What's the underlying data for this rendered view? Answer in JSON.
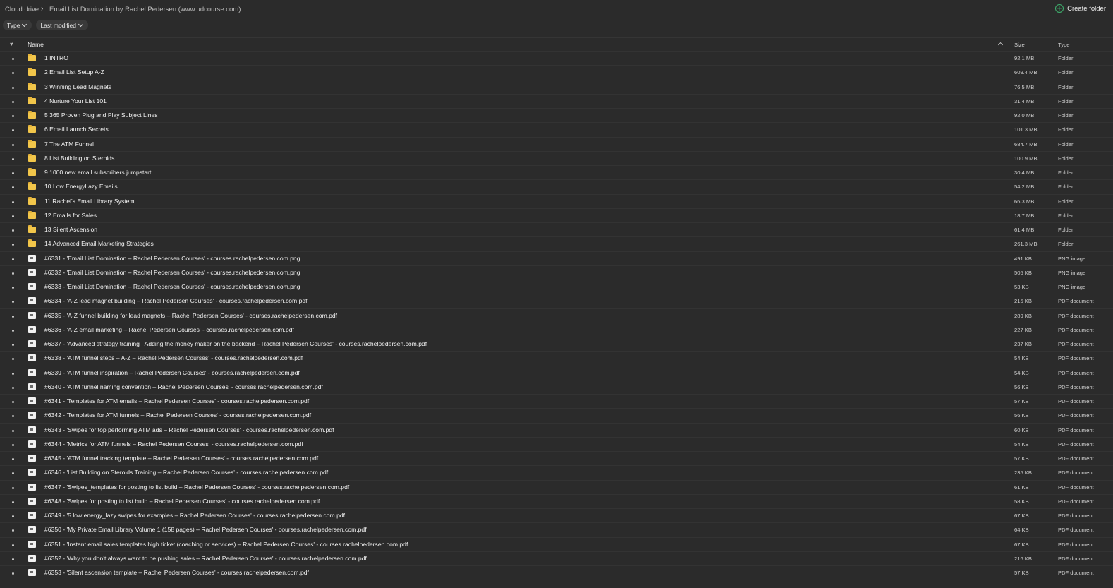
{
  "breadcrumb": {
    "root": "Cloud drive",
    "separator": "›",
    "current": "Email List Domination by Rachel Pedersen (www.udcourse.com)"
  },
  "toolbar": {
    "create_folder_label": "Create folder",
    "filters": [
      {
        "label": "Type"
      },
      {
        "label": "Last modified"
      }
    ]
  },
  "columns": {
    "favourite_icon": "heart-icon",
    "name": "Name",
    "size": "Size",
    "type": "Type",
    "sort": "ascending"
  },
  "colors": {
    "background": "#2b2b2b",
    "folder": "#f2c64a",
    "accent": "#3fb36f"
  },
  "files": [
    {
      "name": "1 INTRO",
      "size": "92.1 MB",
      "type": "Folder",
      "icon": "folder-icon"
    },
    {
      "name": "2 Email List Setup A-Z",
      "size": "609.4 MB",
      "type": "Folder",
      "icon": "folder-icon"
    },
    {
      "name": "3 Winning Lead Magnets",
      "size": "76.5 MB",
      "type": "Folder",
      "icon": "folder-icon"
    },
    {
      "name": "4 Nurture Your List 101",
      "size": "31.4 MB",
      "type": "Folder",
      "icon": "folder-icon"
    },
    {
      "name": "5 365 Proven Plug and Play Subject Lines",
      "size": "92.0 MB",
      "type": "Folder",
      "icon": "folder-icon"
    },
    {
      "name": "6 Email Launch Secrets",
      "size": "101.3 MB",
      "type": "Folder",
      "icon": "folder-icon"
    },
    {
      "name": "7 The ATM Funnel",
      "size": "684.7 MB",
      "type": "Folder",
      "icon": "folder-icon"
    },
    {
      "name": "8 List Building on Steroids",
      "size": "100.9 MB",
      "type": "Folder",
      "icon": "folder-icon"
    },
    {
      "name": "9 1000 new email subscribers jumpstart",
      "size": "30.4 MB",
      "type": "Folder",
      "icon": "folder-icon"
    },
    {
      "name": "10 Low EnergyLazy Emails",
      "size": "54.2 MB",
      "type": "Folder",
      "icon": "folder-icon"
    },
    {
      "name": "11 Rachel's Email Library System",
      "size": "66.3 MB",
      "type": "Folder",
      "icon": "folder-icon"
    },
    {
      "name": "12 Emails for Sales",
      "size": "18.7 MB",
      "type": "Folder",
      "icon": "folder-icon"
    },
    {
      "name": "13 Silent Ascension",
      "size": "61.4 MB",
      "type": "Folder",
      "icon": "folder-icon"
    },
    {
      "name": "14 Advanced Email Marketing Strategies",
      "size": "261.3 MB",
      "type": "Folder",
      "icon": "folder-icon"
    },
    {
      "name": "#6331 - 'Email List Domination – Rachel Pedersen Courses' - courses.rachelpedersen.com.png",
      "size": "491 KB",
      "type": "PNG image",
      "icon": "image-file-icon"
    },
    {
      "name": "#6332 - 'Email List Domination – Rachel Pedersen Courses' - courses.rachelpedersen.com.png",
      "size": "505 KB",
      "type": "PNG image",
      "icon": "image-file-icon"
    },
    {
      "name": "#6333 - 'Email List Domination – Rachel Pedersen Courses' - courses.rachelpedersen.com.png",
      "size": "53 KB",
      "type": "PNG image",
      "icon": "image-file-icon"
    },
    {
      "name": "#6334 - 'A-Z lead magnet building – Rachel Pedersen Courses' - courses.rachelpedersen.com.pdf",
      "size": "215 KB",
      "type": "PDF document",
      "icon": "pdf-file-icon"
    },
    {
      "name": "#6335 - 'A-Z funnel building for lead magnets – Rachel Pedersen Courses' - courses.rachelpedersen.com.pdf",
      "size": "289 KB",
      "type": "PDF document",
      "icon": "pdf-file-icon"
    },
    {
      "name": "#6336 - 'A-Z email marketing – Rachel Pedersen Courses' - courses.rachelpedersen.com.pdf",
      "size": "227 KB",
      "type": "PDF document",
      "icon": "pdf-file-icon"
    },
    {
      "name": "#6337 - 'Advanced strategy training_ Adding the money maker on the backend – Rachel Pedersen Courses' - courses.rachelpedersen.com.pdf",
      "size": "237 KB",
      "type": "PDF document",
      "icon": "pdf-file-icon"
    },
    {
      "name": "#6338 - 'ATM funnel steps – A-Z – Rachel Pedersen Courses' - courses.rachelpedersen.com.pdf",
      "size": "54 KB",
      "type": "PDF document",
      "icon": "pdf-file-icon"
    },
    {
      "name": "#6339 - 'ATM funnel inspiration – Rachel Pedersen Courses' - courses.rachelpedersen.com.pdf",
      "size": "54 KB",
      "type": "PDF document",
      "icon": "pdf-file-icon"
    },
    {
      "name": "#6340 - 'ATM funnel naming convention – Rachel Pedersen Courses' - courses.rachelpedersen.com.pdf",
      "size": "56 KB",
      "type": "PDF document",
      "icon": "pdf-file-icon"
    },
    {
      "name": "#6341 - 'Templates for ATM emails – Rachel Pedersen Courses' - courses.rachelpedersen.com.pdf",
      "size": "57 KB",
      "type": "PDF document",
      "icon": "pdf-file-icon"
    },
    {
      "name": "#6342 - 'Templates for ATM funnels – Rachel Pedersen Courses' - courses.rachelpedersen.com.pdf",
      "size": "56 KB",
      "type": "PDF document",
      "icon": "pdf-file-icon"
    },
    {
      "name": "#6343 - 'Swipes for top performing ATM ads – Rachel Pedersen Courses' - courses.rachelpedersen.com.pdf",
      "size": "60 KB",
      "type": "PDF document",
      "icon": "pdf-file-icon"
    },
    {
      "name": "#6344 - 'Metrics for ATM funnels – Rachel Pedersen Courses' - courses.rachelpedersen.com.pdf",
      "size": "54 KB",
      "type": "PDF document",
      "icon": "pdf-file-icon"
    },
    {
      "name": "#6345 - 'ATM funnel tracking template – Rachel Pedersen Courses' - courses.rachelpedersen.com.pdf",
      "size": "57 KB",
      "type": "PDF document",
      "icon": "pdf-file-icon"
    },
    {
      "name": "#6346 - 'List Building on Steroids Training – Rachel Pedersen Courses' - courses.rachelpedersen.com.pdf",
      "size": "235 KB",
      "type": "PDF document",
      "icon": "pdf-file-icon"
    },
    {
      "name": "#6347 - 'Swipes_templates for posting to list build – Rachel Pedersen Courses' - courses.rachelpedersen.com.pdf",
      "size": "61 KB",
      "type": "PDF document",
      "icon": "pdf-file-icon"
    },
    {
      "name": "#6348 - 'Swipes for posting to list build – Rachel Pedersen Courses' - courses.rachelpedersen.com.pdf",
      "size": "58 KB",
      "type": "PDF document",
      "icon": "pdf-file-icon"
    },
    {
      "name": "#6349 - '5 low energy_lazy swipes for examples – Rachel Pedersen Courses' - courses.rachelpedersen.com.pdf",
      "size": "67 KB",
      "type": "PDF document",
      "icon": "pdf-file-icon"
    },
    {
      "name": "#6350 - 'My Private Email Library Volume 1 (158 pages) – Rachel Pedersen Courses' - courses.rachelpedersen.com.pdf",
      "size": "64 KB",
      "type": "PDF document",
      "icon": "pdf-file-icon"
    },
    {
      "name": "#6351 - 'Instant email sales templates high ticket (coaching or services) – Rachel Pedersen Courses' - courses.rachelpedersen.com.pdf",
      "size": "67 KB",
      "type": "PDF document",
      "icon": "pdf-file-icon"
    },
    {
      "name": "#6352 - 'Why you don't always want to be pushing sales – Rachel Pedersen Courses' - courses.rachelpedersen.com.pdf",
      "size": "216 KB",
      "type": "PDF document",
      "icon": "pdf-file-icon"
    },
    {
      "name": "#6353 - 'Silent ascension template – Rachel Pedersen Courses' - courses.rachelpedersen.com.pdf",
      "size": "57 KB",
      "type": "PDF document",
      "icon": "pdf-file-icon"
    }
  ]
}
